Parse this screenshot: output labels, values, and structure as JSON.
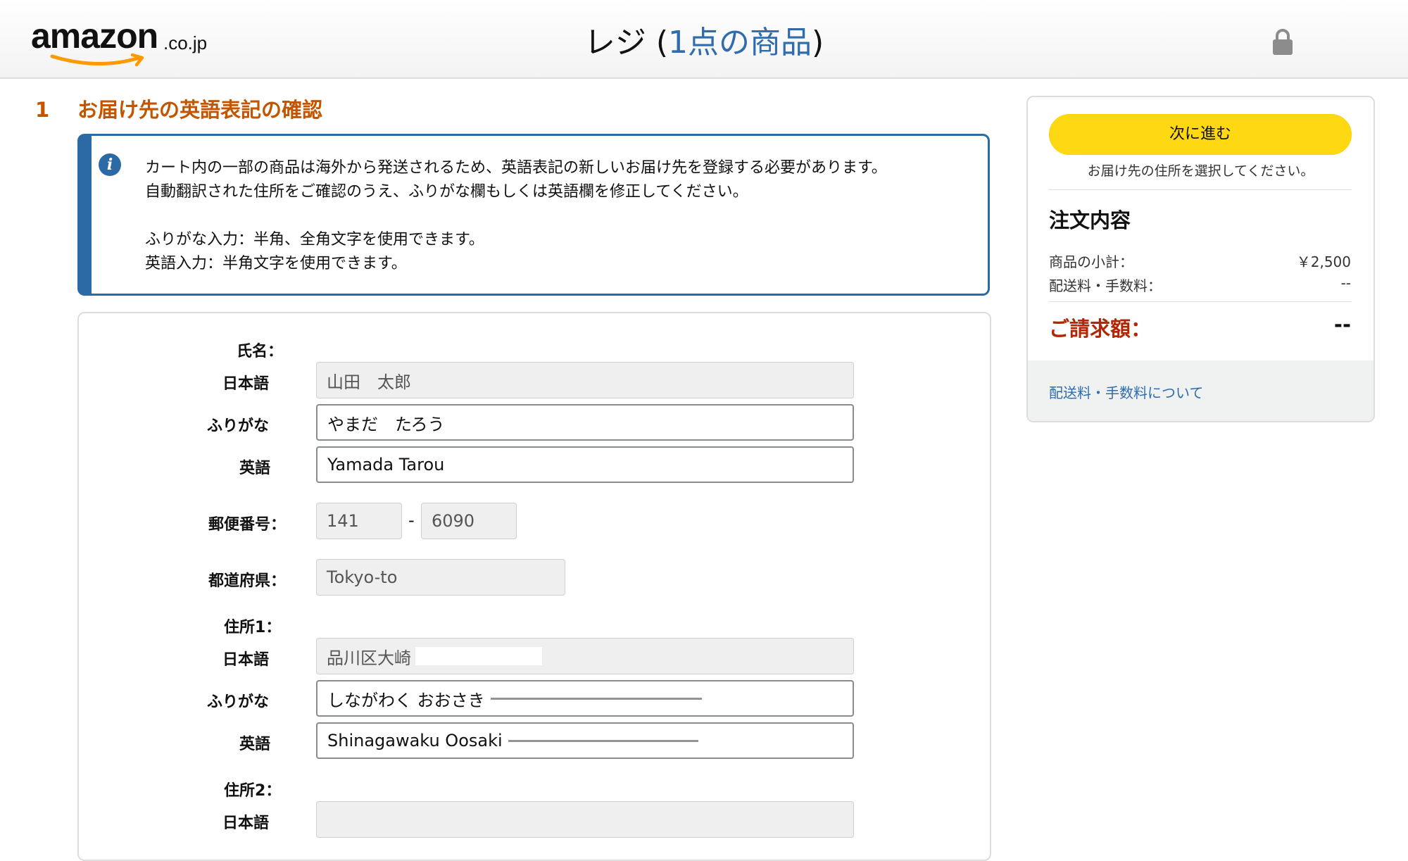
{
  "header": {
    "logo_text": "amazon",
    "logo_tld": ".co.jp",
    "title_main": "レジ (",
    "title_count": "1点の商品",
    "title_close": ")",
    "icons": {
      "lock": "lock-icon"
    }
  },
  "step": {
    "number": "1",
    "title": "お届け先の英語表記の確認"
  },
  "info": {
    "icon": "info-icon",
    "line1": "カート内の一部の商品は海外から発送されるため、英語表記の新しいお届け先を登録する必要があります。",
    "line2": "自動翻訳された住所をご確認のうえ、ふりがな欄もしくは英語欄を修正してください。",
    "line3": "ふりがな入力：半角、全角文字を使用できます。",
    "line4": "英語入力：半角文字を使用できます。"
  },
  "form": {
    "name_label": "氏名：",
    "name_ja_label": "日本語",
    "name_ja_value": "山田　太郎",
    "name_kana_label": "ふりがな",
    "name_kana_value": "やまだ　たろう",
    "name_en_label": "英語",
    "name_en_value": "Yamada Tarou",
    "postal_label": "郵便番号：",
    "postal_1": "141",
    "postal_sep": "-",
    "postal_2": "6090",
    "pref_label": "都道府県：",
    "pref_value": "Tokyo-to",
    "addr1_label": "住所1：",
    "addr1_ja_label": "日本語",
    "addr1_ja_value": "品川区大崎",
    "addr1_kana_label": "ふりがな",
    "addr1_kana_value": "しながわく おおさき",
    "addr1_en_label": "英語",
    "addr1_en_value": "Shinagawaku Oosaki",
    "addr2_label": "住所2：",
    "addr2_ja_label": "日本語",
    "addr2_ja_value": ""
  },
  "summary": {
    "next_button": "次に進む",
    "next_note": "お届け先の住所を選択してください。",
    "title": "注文内容",
    "subtotal_label": "商品の小計：",
    "subtotal_value": "￥2,500",
    "shipping_label": "配送料・手数料：",
    "shipping_value": "--",
    "total_label": "ご請求額：",
    "total_value": "--",
    "footer_link": "配送料・手数料について"
  },
  "colors": {
    "accent_orange": "#c45500",
    "info_blue": "#2b6aa5",
    "button_yellow": "#ffd814",
    "total_red": "#b12704",
    "link_blue": "#2e6cae"
  }
}
